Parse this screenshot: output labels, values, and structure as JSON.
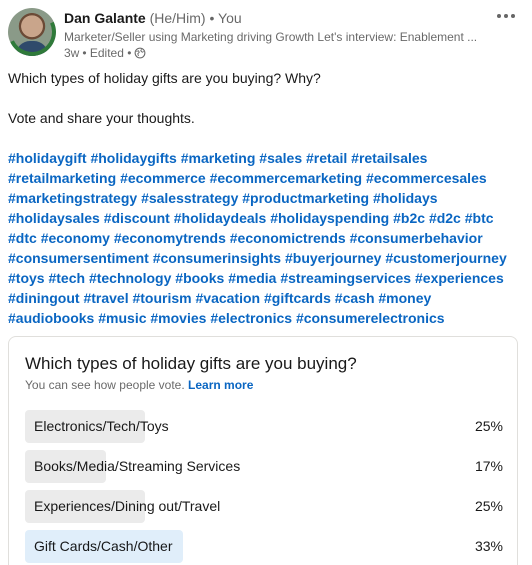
{
  "author": {
    "name": "Dan Galante",
    "pronouns": "(He/Him)",
    "separator": "•",
    "you": "You",
    "headline": "Marketer/Seller using Marketing driving Growth Let's interview: Enablement ...",
    "time": "3w",
    "edited": "• Edited •",
    "visibility_icon": "globe-icon",
    "avatar_badge": "open-to-work"
  },
  "post": {
    "line1": "Which types of holiday gifts are you buying? Why?",
    "line2": "Vote and share your thoughts.",
    "hashtags": [
      "#holidaygift",
      "#holidaygifts",
      "#marketing",
      "#sales",
      "#retail",
      "#retailsales",
      "#retailmarketing",
      "#ecommerce",
      "#ecommercemarketing",
      "#ecommercesales",
      "#marketingstrategy",
      "#salesstrategy",
      "#productmarketing",
      "#holidays",
      "#holidaysales",
      "#discount",
      "#holidaydeals",
      "#holidayspending",
      "#b2c",
      "#d2c",
      "#btc",
      "#dtc",
      "#economy",
      "#economytrends",
      "#economictrends",
      "#consumerbehavior",
      "#consumersentiment",
      "#consumerinsights",
      "#buyerjourney",
      "#customerjourney",
      "#toys",
      "#tech",
      "#technology",
      "#books",
      "#media",
      "#streamingservices",
      "#experiences",
      "#diningout",
      "#travel",
      "#tourism",
      "#vacation",
      "#giftcards",
      "#cash",
      "#money",
      "#audiobooks",
      "#music",
      "#movies",
      "#electronics",
      "#consumerelectronics"
    ]
  },
  "poll": {
    "question": "Which types of holiday gifts are you buying?",
    "note": "You can see how people vote.",
    "learn_more": "Learn more",
    "colors": {
      "bar": "#ebebeb",
      "selected_bar": "#e0eefa",
      "link": "#0a66c2"
    },
    "options": [
      {
        "label": "Electronics/Tech/Toys",
        "percent_label": "25%",
        "fill": 0.25,
        "selected": false
      },
      {
        "label": "Books/Media/Streaming Services",
        "percent_label": "17%",
        "fill": 0.17,
        "selected": false
      },
      {
        "label": "Experiences/Dining out/Travel",
        "percent_label": "25%",
        "fill": 0.25,
        "selected": false
      },
      {
        "label": "Gift Cards/Cash/Other",
        "percent_label": "33%",
        "fill": 0.33,
        "selected": true
      }
    ]
  }
}
